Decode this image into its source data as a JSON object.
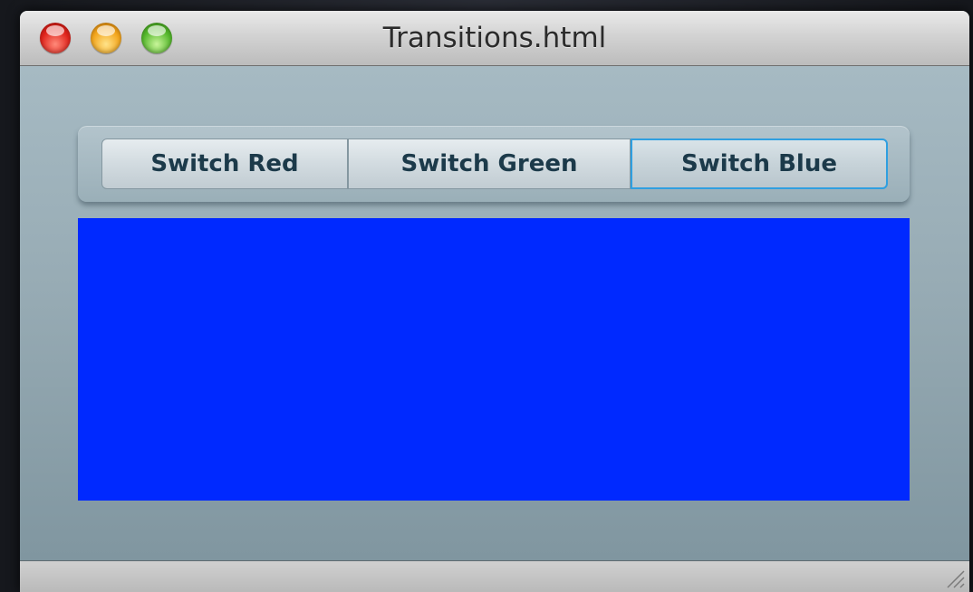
{
  "window": {
    "title": "Transitions.html"
  },
  "toolbar": {
    "buttons": [
      {
        "label": "Switch Red",
        "selected": false
      },
      {
        "label": "Switch Green",
        "selected": false
      },
      {
        "label": "Switch Blue",
        "selected": true
      }
    ]
  },
  "panel": {
    "current_color": "#0029ff"
  },
  "colors": {
    "focus_ring": "#2f9fe0",
    "content_bg": "#97abb4"
  },
  "icons": {
    "close": "close-traffic-light-icon",
    "minimize": "minimize-traffic-light-icon",
    "zoom": "zoom-traffic-light-icon",
    "resize": "resize-grip-icon"
  }
}
